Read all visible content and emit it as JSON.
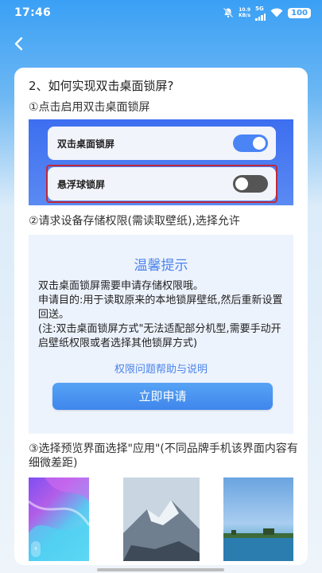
{
  "status_bar": {
    "time": "17:46",
    "net_speed_value": "10.9",
    "net_speed_unit": "KB/s",
    "network": "5G",
    "battery": "100"
  },
  "content": {
    "question_title": "2、如何实现双击桌面锁屏?",
    "step1": "①点击启用双击桌面锁屏",
    "toggle1_label": "双击桌面锁屏",
    "toggle2_label": "悬浮球锁屏",
    "step2": "②请求设备存储权限(需读取壁纸),选择允许",
    "step3": "③选择预览界面选择\"应用\"(不同品牌手机该界面内容有细微差距)"
  },
  "dialog": {
    "title": "温馨提示",
    "line1": "双击桌面锁屏需要申请存储权限哦。",
    "line2": "申请目的:用于读取原来的本地锁屏壁纸,然后重新设置回送。",
    "line3": "(注:双击桌面锁屏方式\"无法适配部分机型,需要手动开启壁纸权限或者选择其他锁屏方式)",
    "help_link": "权限问题帮助与说明",
    "apply_button": "立即申请"
  },
  "colors": {
    "accent": "#4b84ea",
    "toggle_on": "#4a84f5",
    "highlight": "#c0283b"
  },
  "icons": {
    "back": "back-arrow-icon",
    "mute": "bell-off-icon",
    "wifi": "wifi-icon"
  }
}
